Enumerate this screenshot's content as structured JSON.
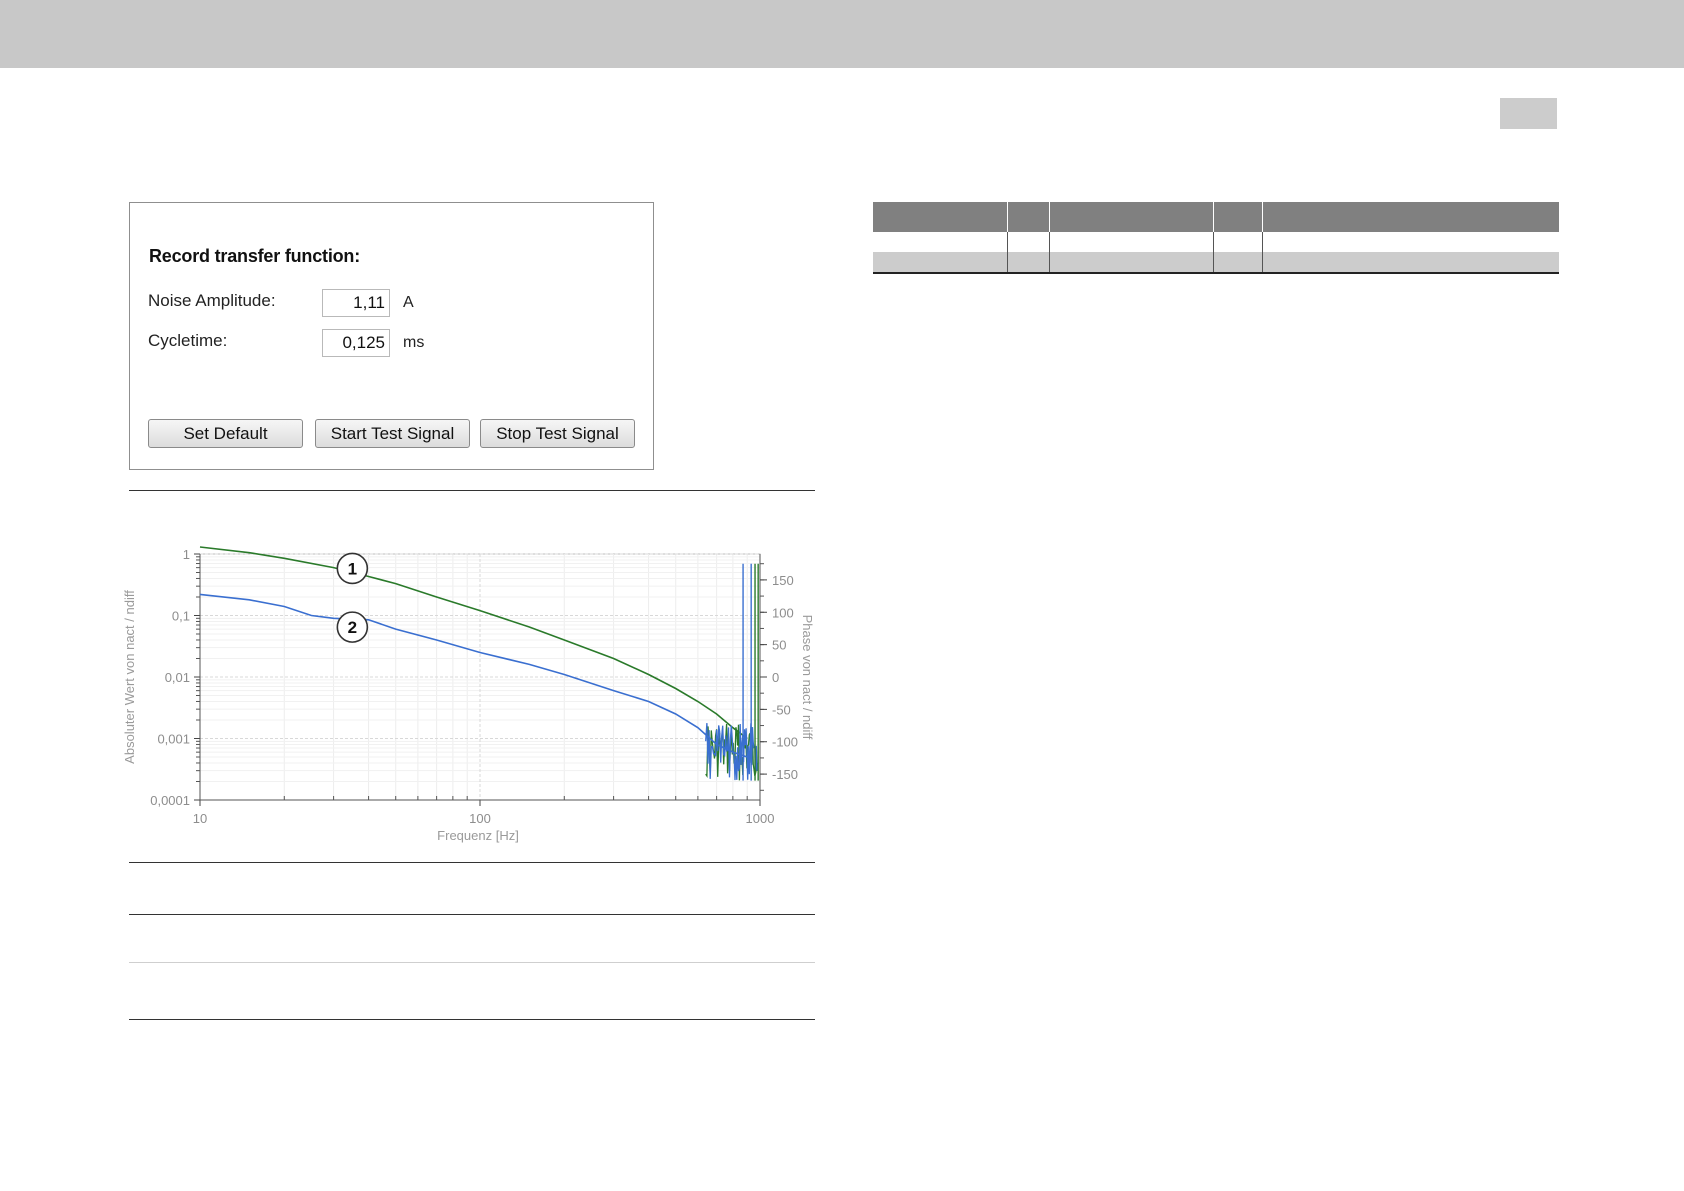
{
  "dialog": {
    "title": "Record transfer function:",
    "noise_amplitude": {
      "label": "Noise Amplitude:",
      "value": "1,11",
      "unit": "A"
    },
    "cycletime": {
      "label": "Cycletime:",
      "value": "0,125",
      "unit": "ms"
    },
    "buttons": {
      "set_default": "Set Default",
      "start_test_signal": "Start Test Signal",
      "stop_test_signal": "Stop Test Signal"
    }
  },
  "chart_data": {
    "type": "line",
    "title": "",
    "xlabel": "Frequenz [Hz]",
    "ylabel": "Absoluter Wert von nact / ndiff",
    "y2label": "Phase von nact / ndiff",
    "x_scale": "log",
    "y_scale": "log",
    "xlim": [
      10,
      1000
    ],
    "ylim": [
      0.0001,
      1
    ],
    "y2lim": [
      -190,
      190
    ],
    "x_ticks": [
      "10",
      "100",
      "1000"
    ],
    "y_ticks": [
      "1",
      "0,1",
      "0,01",
      "0,001",
      "0,0001"
    ],
    "y2_ticks": [
      "150",
      "100",
      "50",
      "0",
      "-50",
      "-100",
      "-150"
    ],
    "grid": true,
    "series": [
      {
        "marker": "1",
        "color": "#2a7a2a",
        "x": [
          10,
          15,
          20,
          30,
          40,
          50,
          70,
          100,
          150,
          200,
          300,
          400,
          500,
          600,
          700,
          800,
          900
        ],
        "y": [
          1.3,
          1.05,
          0.85,
          0.6,
          0.43,
          0.33,
          0.2,
          0.12,
          0.065,
          0.04,
          0.02,
          0.011,
          0.0065,
          0.004,
          0.0025,
          0.0015,
          0.001
        ]
      },
      {
        "marker": "2",
        "color": "#3a6fd0",
        "x": [
          10,
          15,
          20,
          25,
          30,
          40,
          50,
          70,
          100,
          150,
          200,
          300,
          400,
          500,
          600,
          700,
          800,
          900
        ],
        "y": [
          0.22,
          0.18,
          0.14,
          0.1,
          0.09,
          0.085,
          0.06,
          0.04,
          0.025,
          0.016,
          0.011,
          0.006,
          0.004,
          0.0025,
          0.0015,
          0.0008,
          0.0006,
          0.0005
        ]
      }
    ]
  },
  "colors": {
    "header_band": "#c8c8c8",
    "table_header": "#808080",
    "table_row_alt": "#cccccc"
  }
}
